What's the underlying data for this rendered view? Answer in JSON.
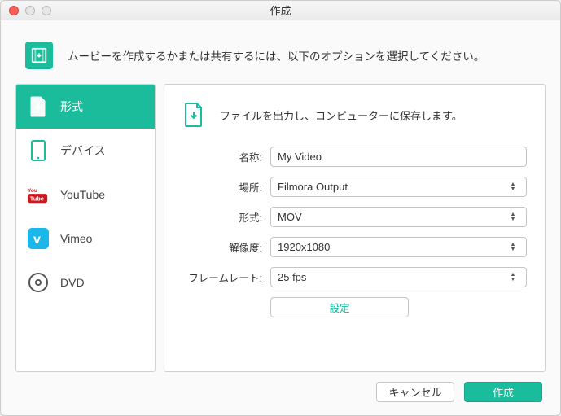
{
  "window": {
    "title": "作成"
  },
  "intro": {
    "text": "ムービーを作成するかまたは共有するには、以下のオプションを選択してください。"
  },
  "sidebar": {
    "items": [
      {
        "label": "形式"
      },
      {
        "label": "デバイス"
      },
      {
        "label": "YouTube"
      },
      {
        "label": "Vimeo"
      },
      {
        "label": "DVD"
      }
    ]
  },
  "content": {
    "header": "ファイルを出力し、コンピューターに保存します。",
    "name_label": "名称:",
    "name_value": "My Video",
    "location_label": "場所:",
    "location_value": "Filmora Output",
    "format_label": "形式:",
    "format_value": "MOV",
    "resolution_label": "解像度:",
    "resolution_value": "1920x1080",
    "framerate_label": "フレームレート:",
    "framerate_value": "25 fps",
    "settings_label": "設定"
  },
  "footer": {
    "cancel": "キャンセル",
    "create": "作成"
  },
  "colors": {
    "accent": "#1abc9c"
  }
}
